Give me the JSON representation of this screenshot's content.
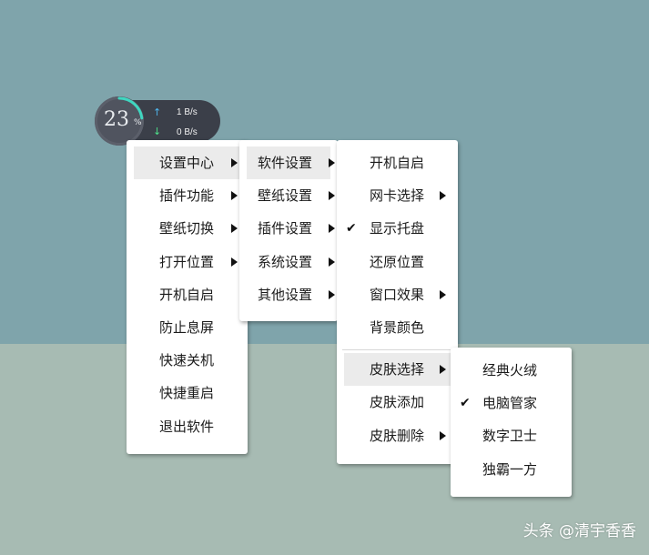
{
  "widget": {
    "cpu_percent_value": "23",
    "cpu_percent_sign": "%",
    "cpu_usage_fraction": 0.23,
    "upload_icon": "up-arrow-icon",
    "download_icon": "down-arrow-icon",
    "upload_speed": "1 B/s",
    "download_speed": "0 B/s",
    "ring_color": "#3fd6c0"
  },
  "menu_main": {
    "items": [
      {
        "label": "设置中心",
        "has_submenu": true,
        "highlighted": true
      },
      {
        "label": "插件功能",
        "has_submenu": true
      },
      {
        "label": "壁纸切换",
        "has_submenu": true
      },
      {
        "label": "打开位置",
        "has_submenu": true
      },
      {
        "label": "开机自启"
      },
      {
        "label": "防止息屏"
      },
      {
        "label": "快速关机"
      },
      {
        "label": "快捷重启"
      },
      {
        "label": "退出软件"
      }
    ]
  },
  "menu_settings": {
    "items": [
      {
        "label": "软件设置",
        "has_submenu": true,
        "highlighted": true
      },
      {
        "label": "壁纸设置",
        "has_submenu": true
      },
      {
        "label": "插件设置",
        "has_submenu": true
      },
      {
        "label": "系统设置",
        "has_submenu": true
      },
      {
        "label": "其他设置",
        "has_submenu": true
      }
    ]
  },
  "menu_software": {
    "items": [
      {
        "label": "开机自启"
      },
      {
        "label": "网卡选择",
        "has_submenu": true
      },
      {
        "label": "显示托盘",
        "checked": true
      },
      {
        "label": "还原位置"
      },
      {
        "label": "窗口效果",
        "has_submenu": true
      },
      {
        "label": "背景颜色"
      },
      {
        "label": "皮肤选择",
        "has_submenu": true,
        "highlighted": true
      },
      {
        "label": "皮肤添加"
      },
      {
        "label": "皮肤删除",
        "has_submenu": true
      }
    ]
  },
  "menu_skin": {
    "items": [
      {
        "label": "经典火绒"
      },
      {
        "label": "电脑管家",
        "checked": true
      },
      {
        "label": "数字卫士"
      },
      {
        "label": "独霸一方"
      }
    ]
  },
  "check_glyph": "✔",
  "watermark": "头条 @清宇香香",
  "colors": {
    "wallpaper_top": "#7fa4ab",
    "wallpaper_bottom": "#a7bbb3",
    "menu_bg": "#ffffff",
    "menu_highlight": "#ebebeb"
  }
}
